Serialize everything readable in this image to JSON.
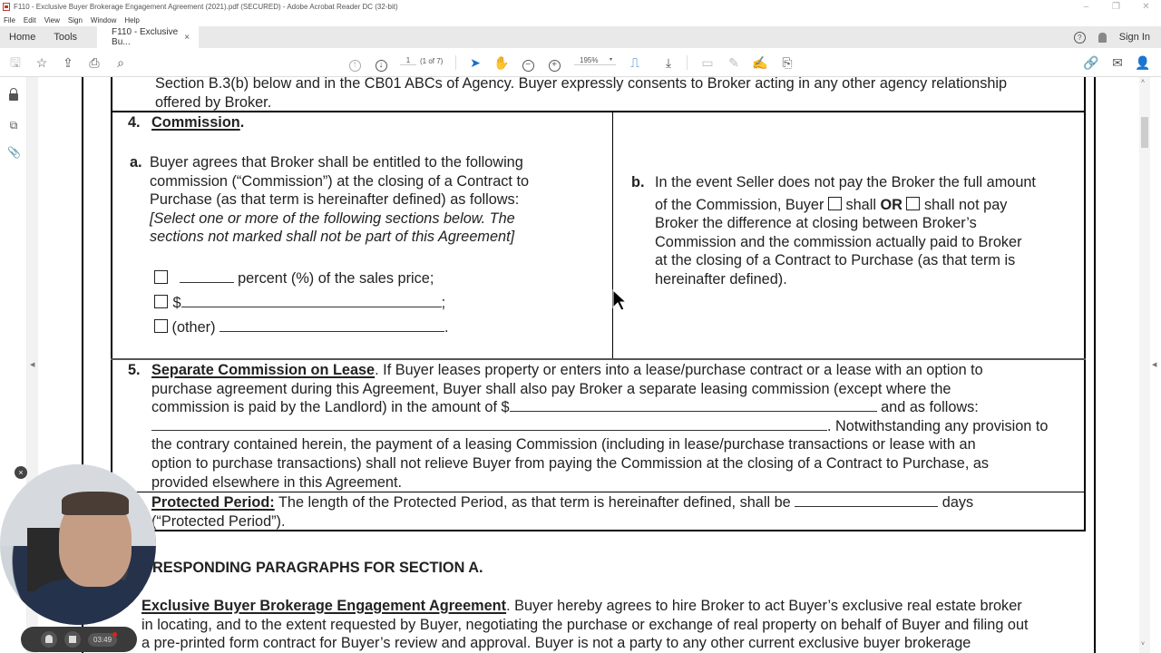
{
  "window": {
    "title": "F110 - Exclusive Buyer Brokerage Engagement Agreement (2021).pdf (SECURED) - Adobe Acrobat Reader DC (32-bit)",
    "controls": [
      "–",
      "❐",
      "✕"
    ]
  },
  "menu": [
    "File",
    "Edit",
    "View",
    "Sign",
    "Window",
    "Help"
  ],
  "tabs": {
    "home": "Home",
    "tools": "Tools",
    "document_tab": "F110 - Exclusive Bu...",
    "close": "×",
    "sign_in": "Sign In",
    "help": "?"
  },
  "toolbar": {
    "page_current": "1",
    "page_count": "(1 of 7)",
    "zoom_level": "195%",
    "zoom_caret": "▾"
  },
  "document": {
    "intro_line1": "Section B.3(b) below and in the CB01 ABCs of Agency. Buyer expressly consents to Broker acting in any other agency relationship",
    "intro_line2": "offered by Broker.",
    "s4_num": "4.",
    "s4_title": "Commission",
    "s4a_label": "a.",
    "s4a_lines": [
      "Buyer agrees that Broker shall be entitled to the following",
      "commission (“Commission”) at the closing of a Contract to",
      "Purchase (as that term is hereinafter defined) as follows:"
    ],
    "s4a_italic": [
      "[Select one or more of the following sections below. The",
      "sections not marked shall not be part of this Agreement]"
    ],
    "options": {
      "percent": "percent (%) of the sales price;",
      "dollar_prefix": "$",
      "dollar_suffix": ";",
      "other_prefix": "(other)",
      "other_suffix": "."
    },
    "s4b_label": "b.",
    "s4b_line1": "In the event Seller does not pay the Broker the full amount",
    "s4b_line2_a": "of the Commission, Buyer",
    "s4b_line2_b": "shall",
    "s4b_line2_or": "OR",
    "s4b_line2_c": "shall not pay",
    "s4b_lines": [
      "Broker the difference at closing between Broker’s",
      "Commission and the commission actually paid to Broker",
      "at the closing of a Contract to Purchase (as that term is",
      "hereinafter defined)."
    ],
    "s5_num": "5.",
    "s5_title": "Separate Commission on Lease",
    "s5_line1_rest": ". If Buyer leases property or enters into a lease/purchase contract or a lease with an option to",
    "s5_line2": "purchase agreement during this Agreement, Buyer shall also pay Broker a separate leasing commission (except where the",
    "s5_line3_a": "commission is paid by the Landlord) in the amount of $",
    "s5_line3_b": "and as follows:",
    "s5_line4_b": ". Notwithstanding any provision to",
    "s5_lines": [
      "the contrary contained herein, the payment of a leasing Commission (including in lease/purchase transactions or lease with an",
      "option to purchase transactions) shall not relieve Buyer from paying the Commission at the closing of a Contract to Purchase, as",
      "provided elsewhere in this Agreement."
    ],
    "s6_title": "Protected Period:",
    "s6_line1_rest": "The length of the Protected Period, as that term is hereinafter defined, shall be",
    "s6_line1_end": "days",
    "s6_line2": "(“Protected Period”).",
    "section_heading": "RESPONDING PARAGRAPHS FOR SECTION A.",
    "b1_title": "Exclusive Buyer Brokerage Engagement Agreement",
    "b1_line1_rest": ". Buyer hereby agrees to hire Broker to act Buyer’s exclusive real estate broker",
    "b1_lines": [
      "in locating, and to the extent requested by Buyer, negotiating the purchase or exchange of real property on behalf of Buyer and filing out",
      "a pre-printed form contract for Buyer’s review and approval. Buyer is not a party to any other current exclusive buyer brokerage"
    ]
  },
  "recorder": {
    "elapsed": "03:49",
    "close": "×"
  }
}
